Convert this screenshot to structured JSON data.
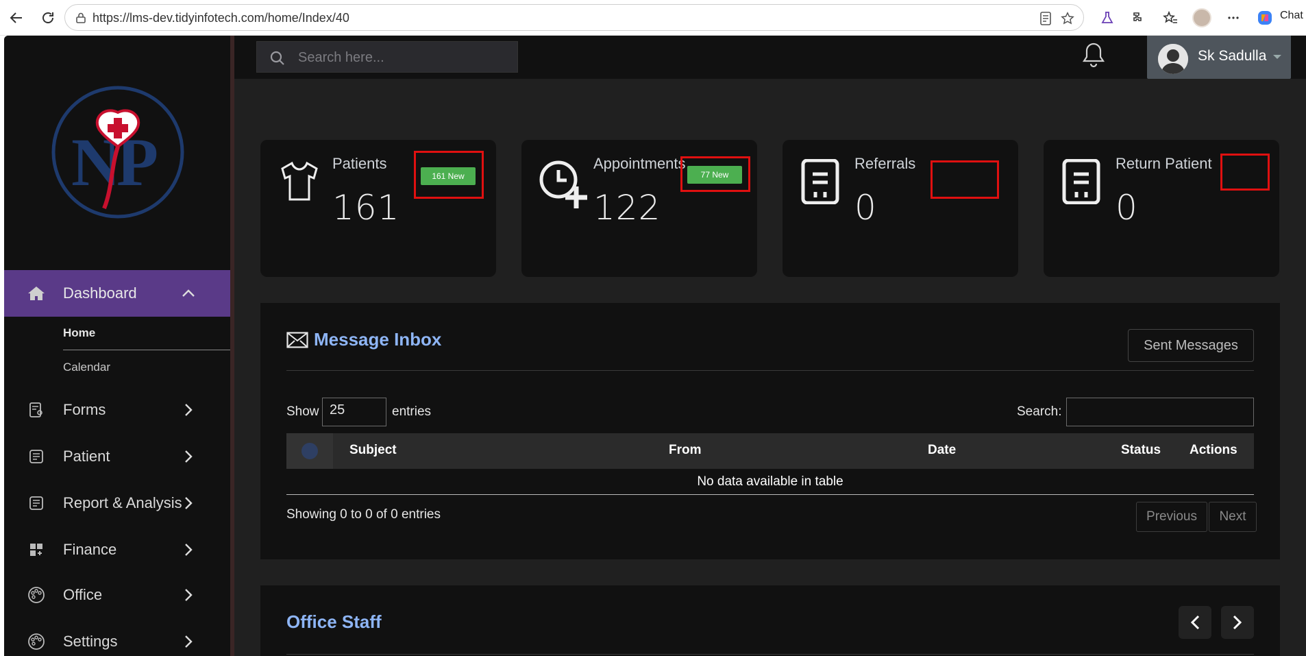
{
  "browser": {
    "url": "https://lms-dev.tidyinfotech.com/home/Index/40",
    "chat_label": "Chat"
  },
  "sidebar": {
    "logo_alt": "NP",
    "active": {
      "label": "Dashboard"
    },
    "subitems": [
      {
        "label": "Home"
      },
      {
        "label": "Calendar"
      }
    ],
    "items": [
      {
        "label": "Forms",
        "icon": "form-icon"
      },
      {
        "label": "Patient",
        "icon": "list-icon"
      },
      {
        "label": "Report & Analysis",
        "icon": "report-icon"
      },
      {
        "label": "Finance",
        "icon": "grid-icon"
      },
      {
        "label": "Office",
        "icon": "palette-icon"
      },
      {
        "label": "Settings",
        "icon": "palette-icon"
      }
    ]
  },
  "topbar": {
    "search_placeholder": "Search here...",
    "user_name": "Sk Sadulla"
  },
  "cards": [
    {
      "title": "Patients",
      "value": "161",
      "badge": "161 New"
    },
    {
      "title": "Appointments",
      "value": "122",
      "badge": "77 New"
    },
    {
      "title": "Referrals",
      "value": "0",
      "badge": ""
    },
    {
      "title": "Return Patient",
      "value": "0",
      "badge": ""
    }
  ],
  "inbox": {
    "title": "Message Inbox",
    "sent_button": "Sent Messages",
    "show_label": "Show",
    "entries_value": "25",
    "entries_label": "entries",
    "search_label": "Search:",
    "columns": [
      "Subject",
      "From",
      "Date",
      "Status",
      "Actions"
    ],
    "empty_text": "No data available in table",
    "info_text": "Showing 0 to 0 of 0 entries",
    "prev_label": "Previous",
    "next_label": "Next"
  },
  "office_staff": {
    "title": "Office Staff"
  },
  "colors": {
    "accent_purple": "#5a3a88",
    "title_blue": "#8eb5f5",
    "badge_green": "#4caf50",
    "highlight_red": "#e01010"
  }
}
